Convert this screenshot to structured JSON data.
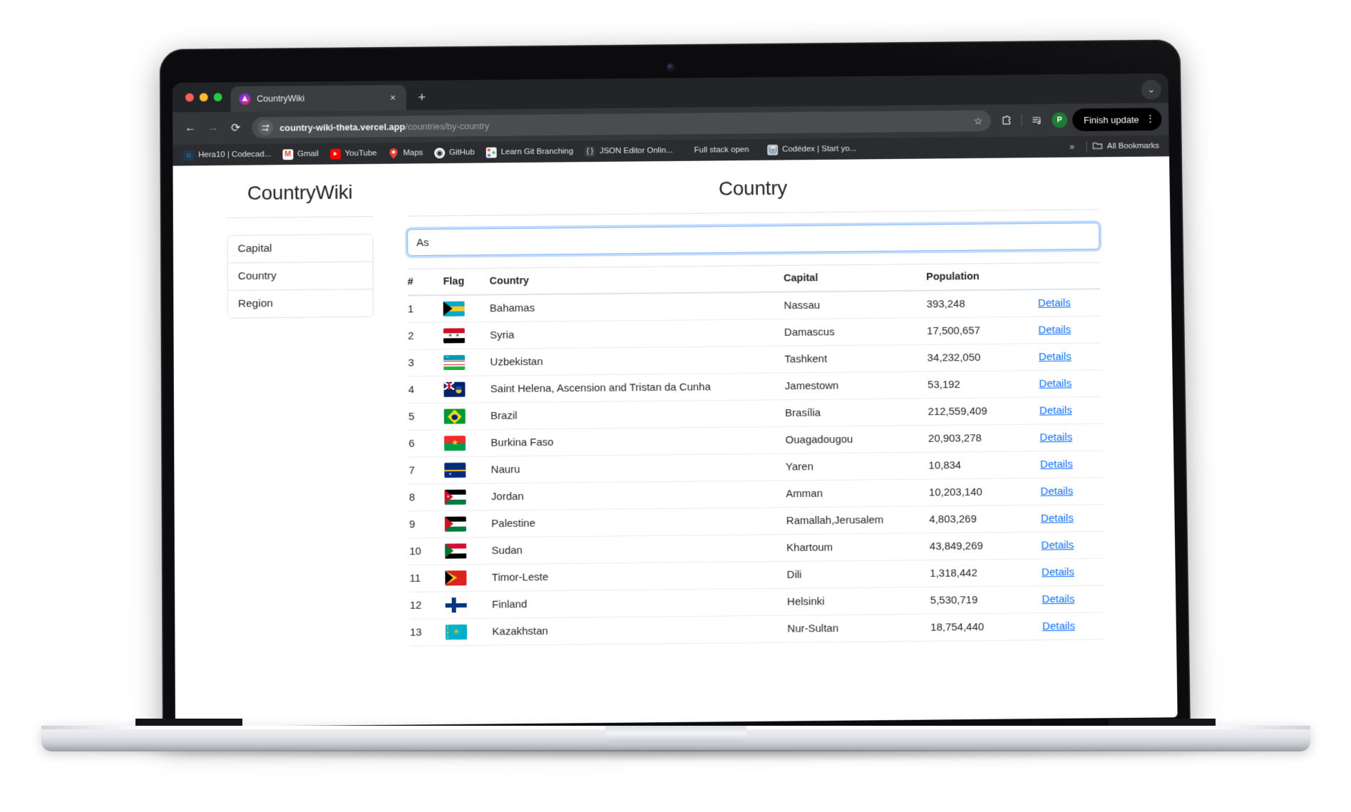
{
  "browser": {
    "tab": {
      "title": "CountryWiki",
      "favicon": "countrywiki-favicon",
      "close_label": "×",
      "new_tab_label": "+"
    },
    "tabstrip_chevron": "⌄",
    "toolbar": {
      "back": "←",
      "forward": "→",
      "reload": "⟳",
      "url_domain": "country-wiki-theta.vercel.app",
      "url_path": "/countries/by-country",
      "star": "☆",
      "finish_update_label": "Finish update",
      "menu_dots": "⋮",
      "profile_initial": "P"
    },
    "bookmarks": [
      {
        "label": "Hera10 | Codecad...",
        "icon": "codecademy-icon"
      },
      {
        "label": "Gmail",
        "icon": "gmail-icon"
      },
      {
        "label": "YouTube",
        "icon": "youtube-icon"
      },
      {
        "label": "Maps",
        "icon": "google-maps-icon"
      },
      {
        "label": "GitHub",
        "icon": "github-icon"
      },
      {
        "label": "Learn Git Branching",
        "icon": "learn-git-branching-icon"
      },
      {
        "label": "JSON Editor Onlin...",
        "icon": "json-editor-icon"
      },
      {
        "label": "Full stack open",
        "icon": "none"
      },
      {
        "label": "Codédex | Start yo...",
        "icon": "codedex-icon"
      }
    ],
    "bookmarks_overflow": "»",
    "all_bookmarks_label": "All Bookmarks"
  },
  "sidebar": {
    "brand": "CountryWiki",
    "items": [
      {
        "label": "Capital"
      },
      {
        "label": "Country"
      },
      {
        "label": "Region"
      }
    ]
  },
  "main": {
    "title": "Country",
    "search": {
      "value": "As",
      "placeholder": ""
    },
    "table": {
      "columns": [
        "#",
        "Flag",
        "Country",
        "Capital",
        "Population",
        ""
      ],
      "details_label": "Details",
      "rows": [
        {
          "num": "1",
          "flag": "bahamas-flag",
          "country": "Bahamas",
          "capital": "Nassau",
          "population": "393,248"
        },
        {
          "num": "2",
          "flag": "syria-flag",
          "country": "Syria",
          "capital": "Damascus",
          "population": "17,500,657"
        },
        {
          "num": "3",
          "flag": "uzbekistan-flag",
          "country": "Uzbekistan",
          "capital": "Tashkent",
          "population": "34,232,050"
        },
        {
          "num": "4",
          "flag": "saint-helena-flag",
          "country": "Saint Helena, Ascension and Tristan da Cunha",
          "capital": "Jamestown",
          "population": "53,192"
        },
        {
          "num": "5",
          "flag": "brazil-flag",
          "country": "Brazil",
          "capital": "Brasília",
          "population": "212,559,409"
        },
        {
          "num": "6",
          "flag": "burkina-faso-flag",
          "country": "Burkina Faso",
          "capital": "Ouagadougou",
          "population": "20,903,278"
        },
        {
          "num": "7",
          "flag": "nauru-flag",
          "country": "Nauru",
          "capital": "Yaren",
          "population": "10,834"
        },
        {
          "num": "8",
          "flag": "jordan-flag",
          "country": "Jordan",
          "capital": "Amman",
          "population": "10,203,140"
        },
        {
          "num": "9",
          "flag": "palestine-flag",
          "country": "Palestine",
          "capital": "Ramallah,Jerusalem",
          "population": "4,803,269"
        },
        {
          "num": "10",
          "flag": "sudan-flag",
          "country": "Sudan",
          "capital": "Khartoum",
          "population": "43,849,269"
        },
        {
          "num": "11",
          "flag": "timor-leste-flag",
          "country": "Timor-Leste",
          "capital": "Dili",
          "population": "1,318,442"
        },
        {
          "num": "12",
          "flag": "finland-flag",
          "country": "Finland",
          "capital": "Helsinki",
          "population": "5,530,719"
        },
        {
          "num": "13",
          "flag": "kazakhstan-flag",
          "country": "Kazakhstan",
          "capital": "Nur-Sultan",
          "population": "18,754,440"
        }
      ]
    }
  },
  "colors": {
    "link": "#0d6efd",
    "focus_border": "#86b7fe",
    "browser_toolbar": "#35363a",
    "bookmarks_bar": "#2b2c2f",
    "update_button": "#000000",
    "profile_avatar": "#1e7c34"
  }
}
